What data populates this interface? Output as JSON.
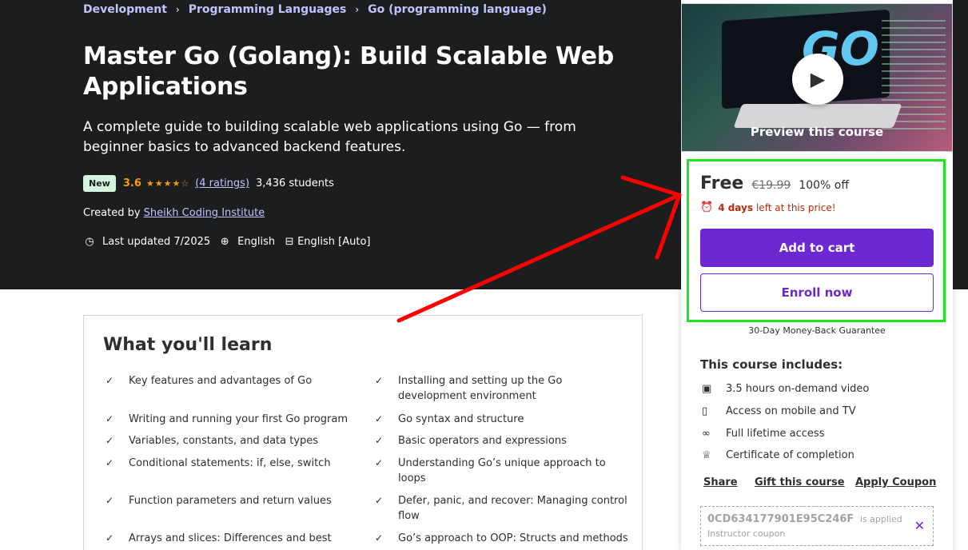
{
  "breadcrumb": [
    "Development",
    "Programming Languages",
    "Go (programming language)"
  ],
  "breadcrumb_sep": "›",
  "course": {
    "title": "Master Go (Golang): Build Scalable Web Applications",
    "subtitle": "A complete guide to building scalable web applications using Go — from beginner basics to advanced backend features.",
    "badge": "New",
    "rating": "3.6",
    "stars": "★★★★☆",
    "ratings_link": "(4 ratings)",
    "students": "3,436 students",
    "created_by_label": "Created by",
    "instructor": "Sheikh Coding Institute",
    "last_updated": "Last updated 7/2025",
    "language": "English",
    "captions": "English [Auto]"
  },
  "learn": {
    "title": "What you'll learn",
    "items": [
      "Key features and advantages of Go",
      "Installing and setting up the Go development environment",
      "Writing and running your first Go program",
      "Go syntax and structure",
      "Variables, constants, and data types",
      "Basic operators and expressions",
      "Conditional statements: if, else, switch",
      "Understanding Go’s unique approach to loops",
      "Function parameters and return values",
      "Defer, panic, and recover: Managing control flow",
      "Arrays and slices: Differences and best",
      "Go’s approach to OOP: Structs and methods"
    ]
  },
  "preview": {
    "label": "Preview this course",
    "logo": "GO"
  },
  "pricing": {
    "price": "Free",
    "original": "€19.99",
    "discount": "100% off",
    "timer_bold": "4 days",
    "timer_rest": "left at this price!",
    "add_to_cart": "Add to cart",
    "enroll_now": "Enroll now",
    "guarantee": "30-Day Money-Back Guarantee"
  },
  "includes": {
    "title": "This course includes:",
    "items": [
      "3.5 hours on-demand video",
      "Access on mobile and TV",
      "Full lifetime access",
      "Certificate of completion"
    ]
  },
  "actions": {
    "share": "Share",
    "gift": "Gift this course",
    "coupon": "Apply Coupon"
  },
  "coupon": {
    "code": "0CD634177901E95C246F",
    "applied": "is applied",
    "type": "Instructor coupon"
  },
  "colors": {
    "hero_bg": "#1c1d1f",
    "accent_purple": "#6d28d2",
    "link_lavender": "#c0c4fc",
    "star_orange": "#f69c08",
    "timer_red": "#b32d0f",
    "highlight_green": "#1ee41e",
    "annotation_red": "#ff0000"
  }
}
